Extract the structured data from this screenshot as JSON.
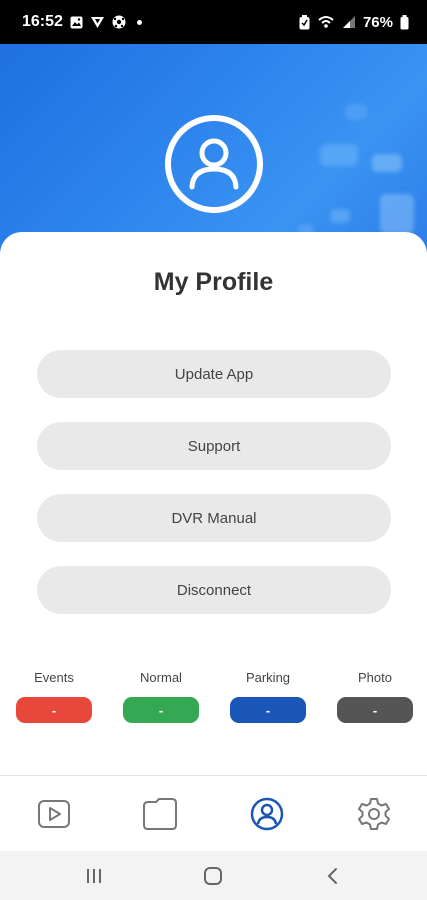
{
  "status_bar": {
    "time": "16:52",
    "battery": "76%",
    "left_icons": [
      "gallery-icon",
      "vpn-icon",
      "soccer-icon",
      "dot-icon"
    ],
    "right_icons": [
      "battery-saver-icon",
      "wifi-calling-icon",
      "signal-icon",
      "battery-icon"
    ]
  },
  "header": {
    "avatar_icon": "user-profile-icon",
    "background_color": "#2f86ee"
  },
  "profile": {
    "title": "My Profile",
    "buttons": [
      {
        "label": "Update App"
      },
      {
        "label": "Support"
      },
      {
        "label": "DVR Manual"
      },
      {
        "label": "Disconnect"
      }
    ]
  },
  "legend": [
    {
      "label": "Events",
      "value": "-",
      "color": "#e8473b"
    },
    {
      "label": "Normal",
      "value": "-",
      "color": "#34a853"
    },
    {
      "label": "Parking",
      "value": "-",
      "color": "#1a56b8"
    },
    {
      "label": "Photo",
      "value": "-",
      "color": "#555555"
    }
  ],
  "bottom_nav": {
    "items": [
      {
        "icon": "video-play-icon",
        "active": false
      },
      {
        "icon": "folder-icon",
        "active": false
      },
      {
        "icon": "profile-icon",
        "active": true
      },
      {
        "icon": "settings-gear-icon",
        "active": false
      }
    ],
    "active_color": "#1a56b8",
    "inactive_color": "#777777"
  },
  "system_nav": {
    "buttons": [
      "recent-apps-icon",
      "home-icon",
      "back-icon"
    ]
  }
}
